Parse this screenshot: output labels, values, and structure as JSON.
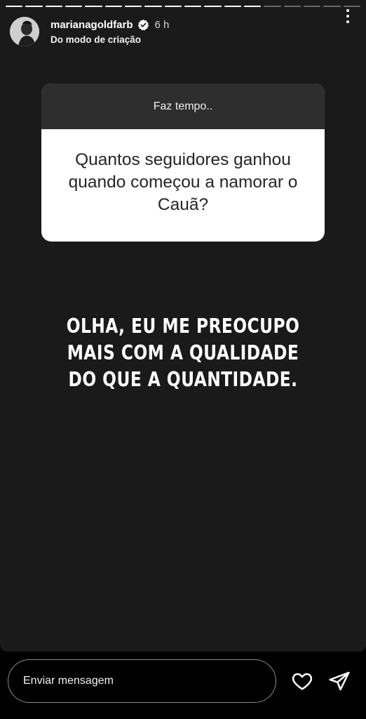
{
  "progress": {
    "total": 18,
    "completed": 13
  },
  "header": {
    "username": "marianagoldfarb",
    "time": "6 h",
    "subtitle": "Do modo de criação",
    "verified_icon": "verified-badge-icon",
    "more_icon": "more-vertical-icon"
  },
  "question": {
    "title": "Faz tempo..",
    "text": "Quantos seguidores ganhou quando começou a namorar o Cauã?"
  },
  "answer": {
    "lines": [
      "OLHA, EU ME PREOCUPO",
      "MAIS COM A QUALIDADE",
      "DO QUE A QUANTIDADE."
    ]
  },
  "footer": {
    "placeholder": "Enviar mensagem",
    "like_icon": "heart-icon",
    "send_icon": "paper-plane-icon"
  },
  "colors": {
    "story_bg": "#1a1a1a",
    "question_header_bg": "#2e2e2e",
    "question_body_bg": "#ffffff",
    "verified_blue": "#ffffff"
  }
}
